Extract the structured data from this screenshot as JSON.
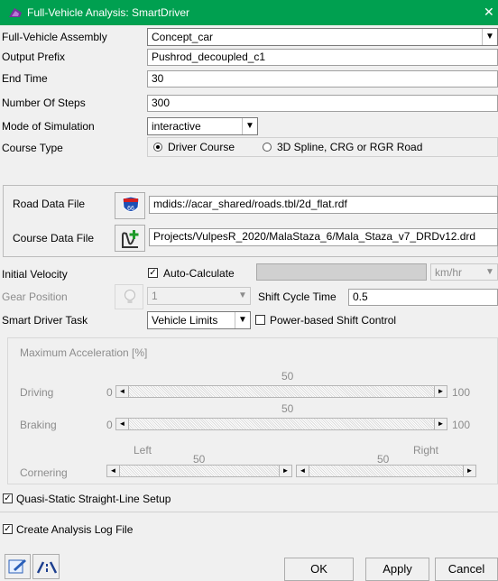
{
  "window": {
    "title": "Full-Vehicle Analysis: SmartDriver",
    "close": "✕"
  },
  "form": {
    "assembly": {
      "label": "Full-Vehicle Assembly",
      "value": "Concept_car"
    },
    "output_prefix": {
      "label": "Output Prefix",
      "value": "Pushrod_decoupled_c1"
    },
    "end_time": {
      "label": "End Time",
      "value": "30"
    },
    "steps": {
      "label": "Number Of Steps",
      "value": "300"
    },
    "mode": {
      "label": "Mode of Simulation",
      "value": "interactive"
    },
    "course_type": {
      "label": "Course Type",
      "option1": "Driver Course",
      "option2": "3D Spline, CRG or RGR Road",
      "selected": "Driver Course"
    }
  },
  "files": {
    "road": {
      "label": "Road Data File",
      "value": "mdids://acar_shared/roads.tbl/2d_flat.rdf",
      "shield": "66"
    },
    "course": {
      "label": "Course Data File",
      "value": "Projects/VulpesR_2020/MalaStaza_6/Mala_Staza_v7_DRDv12.drd"
    }
  },
  "velocity": {
    "label": "Initial Velocity",
    "auto_label": "Auto-Calculate",
    "auto_checked": true,
    "units": "km/hr"
  },
  "gear": {
    "label": "Gear Position",
    "value": "1",
    "shift_label": "Shift Cycle Time",
    "shift_value": "0.5"
  },
  "task": {
    "label": "Smart Driver Task",
    "value": "Vehicle Limits",
    "power_label": "Power-based Shift Control",
    "power_checked": false
  },
  "accel": {
    "title": "Maximum Acceleration [%]",
    "driving": {
      "label": "Driving",
      "min": "0",
      "value": "50",
      "max": "100"
    },
    "braking": {
      "label": "Braking",
      "min": "0",
      "value": "50",
      "max": "100"
    },
    "cornering": {
      "label": "Cornering",
      "left": "Left",
      "right": "Right",
      "left_value": "50",
      "right_value": "50"
    }
  },
  "options": {
    "quasi": {
      "label": "Quasi-Static Straight-Line Setup",
      "checked": true
    },
    "log": {
      "label": "Create Analysis Log File",
      "checked": true
    }
  },
  "buttons": {
    "ok": "OK",
    "apply": "Apply",
    "cancel": "Cancel"
  },
  "icons": {
    "app": "car-icon",
    "road": "highway-shield-icon",
    "course": "add-course-icon",
    "gear": "lightbulb-icon"
  },
  "colors": {
    "titlebar": "#00a050",
    "disabled": "#8c8c8c"
  }
}
